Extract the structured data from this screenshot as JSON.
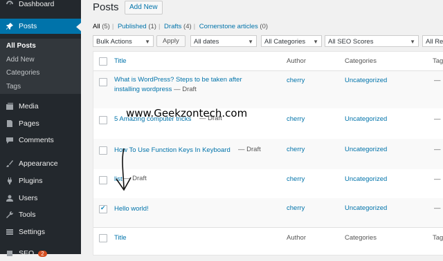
{
  "sidebar": {
    "items": [
      {
        "label": "Dashboard",
        "icon": "dashboard-icon"
      },
      {
        "label": "Posts",
        "icon": "pin-icon",
        "active": true
      },
      {
        "label": "Media",
        "icon": "media-icon"
      },
      {
        "label": "Pages",
        "icon": "pages-icon"
      },
      {
        "label": "Comments",
        "icon": "comments-icon"
      },
      {
        "label": "Appearance",
        "icon": "brush-icon"
      },
      {
        "label": "Plugins",
        "icon": "plugin-icon"
      },
      {
        "label": "Users",
        "icon": "users-icon"
      },
      {
        "label": "Tools",
        "icon": "wrench-icon"
      },
      {
        "label": "Settings",
        "icon": "settings-icon"
      },
      {
        "label": "SEO",
        "icon": "seo-icon",
        "badge": "2"
      }
    ],
    "submenu": [
      "All Posts",
      "Add New",
      "Categories",
      "Tags"
    ]
  },
  "header": {
    "title": "Posts",
    "add_new": "Add New"
  },
  "filters": {
    "all": "All",
    "all_count": "(5)",
    "published": "Published",
    "published_count": "(1)",
    "drafts": "Drafts",
    "drafts_count": "(4)",
    "cornerstone": "Cornerstone articles",
    "cornerstone_count": "(0)"
  },
  "tablenav": {
    "bulk": "Bulk Actions",
    "apply": "Apply",
    "dates": "All dates",
    "categories": "All Categories",
    "seo": "All SEO Scores",
    "readability": "All Rea"
  },
  "columns": {
    "title": "Title",
    "author": "Author",
    "categories": "Categories",
    "tags": "Tags"
  },
  "rows": [
    {
      "title_line1": "What is WordPress? Steps to be taken after",
      "title_line2": "installing wordpress",
      "state": " — Draft",
      "author": "cherry",
      "category": "Uncategorized",
      "tags": "—",
      "checked": false
    },
    {
      "title_line1": "5 Amazing computer tricks",
      "title_line2": "",
      "state": " — Draft",
      "author": "cherry",
      "category": "Uncategorized",
      "tags": "—",
      "checked": false
    },
    {
      "title_line1": "How To Use Function Keys In Keyboard",
      "title_line2": "",
      "state": " — Draft",
      "author": "cherry",
      "category": "Uncategorized",
      "tags": "—",
      "checked": false
    },
    {
      "title_line1": "list",
      "title_line2": "",
      "state": " — Draft",
      "author": "cherry",
      "category": "Uncategorized",
      "tags": "—",
      "checked": false
    },
    {
      "title_line1": "Hello world!",
      "title_line2": "",
      "state": "",
      "author": "cherry",
      "category": "Uncategorized",
      "tags": "—",
      "checked": true
    }
  ],
  "watermark": "www.Geekzontech.com",
  "colors": {
    "accent": "#0073aa",
    "sidebar": "#23282d",
    "submenu": "#32373c"
  }
}
